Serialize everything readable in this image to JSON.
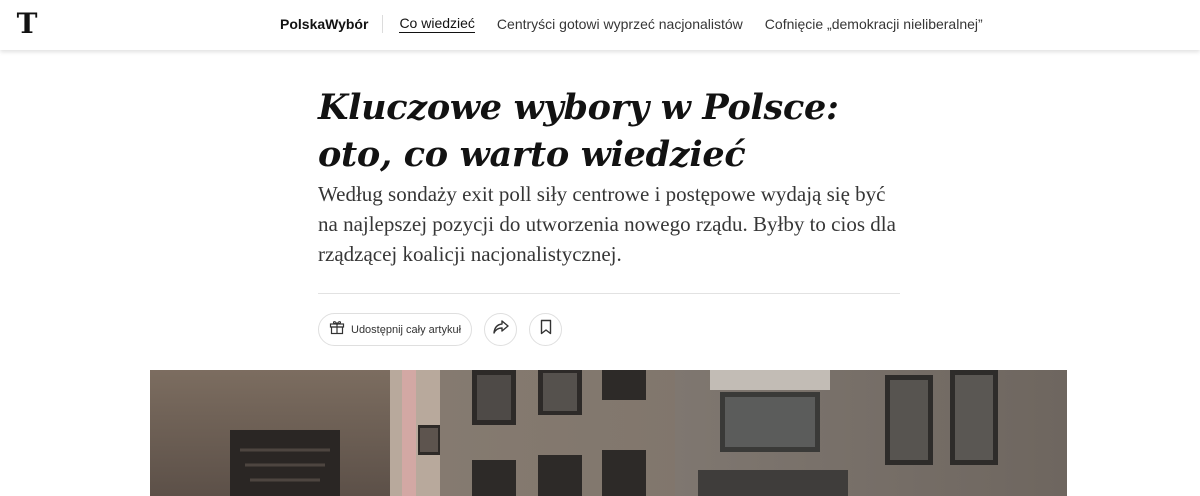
{
  "header": {
    "logo_text": "T",
    "section": "PolskaWybór",
    "links": [
      {
        "label": "Co wiedzieć",
        "active": true
      },
      {
        "label": "Centryści gotowi wyprzeć nacjonalistów",
        "active": false
      },
      {
        "label": "Cofnięcie „demokracji nieliberalnej”",
        "active": false
      }
    ]
  },
  "article": {
    "headline": "Kluczowe wybory w Polsce: oto, co warto wiedzieć",
    "summary": "Według sondaży exit poll siły centrowe i postępowe wydają się być na najlepszej pozycji do utworzenia nowego rządu. Byłby to cios dla rządzącej koalicji nacjonalistycznej.",
    "share_full_label": "Udostępnij cały artykuł"
  },
  "icons": {
    "gift": "gift-icon",
    "share": "share-arrow-icon",
    "bookmark": "bookmark-icon"
  }
}
